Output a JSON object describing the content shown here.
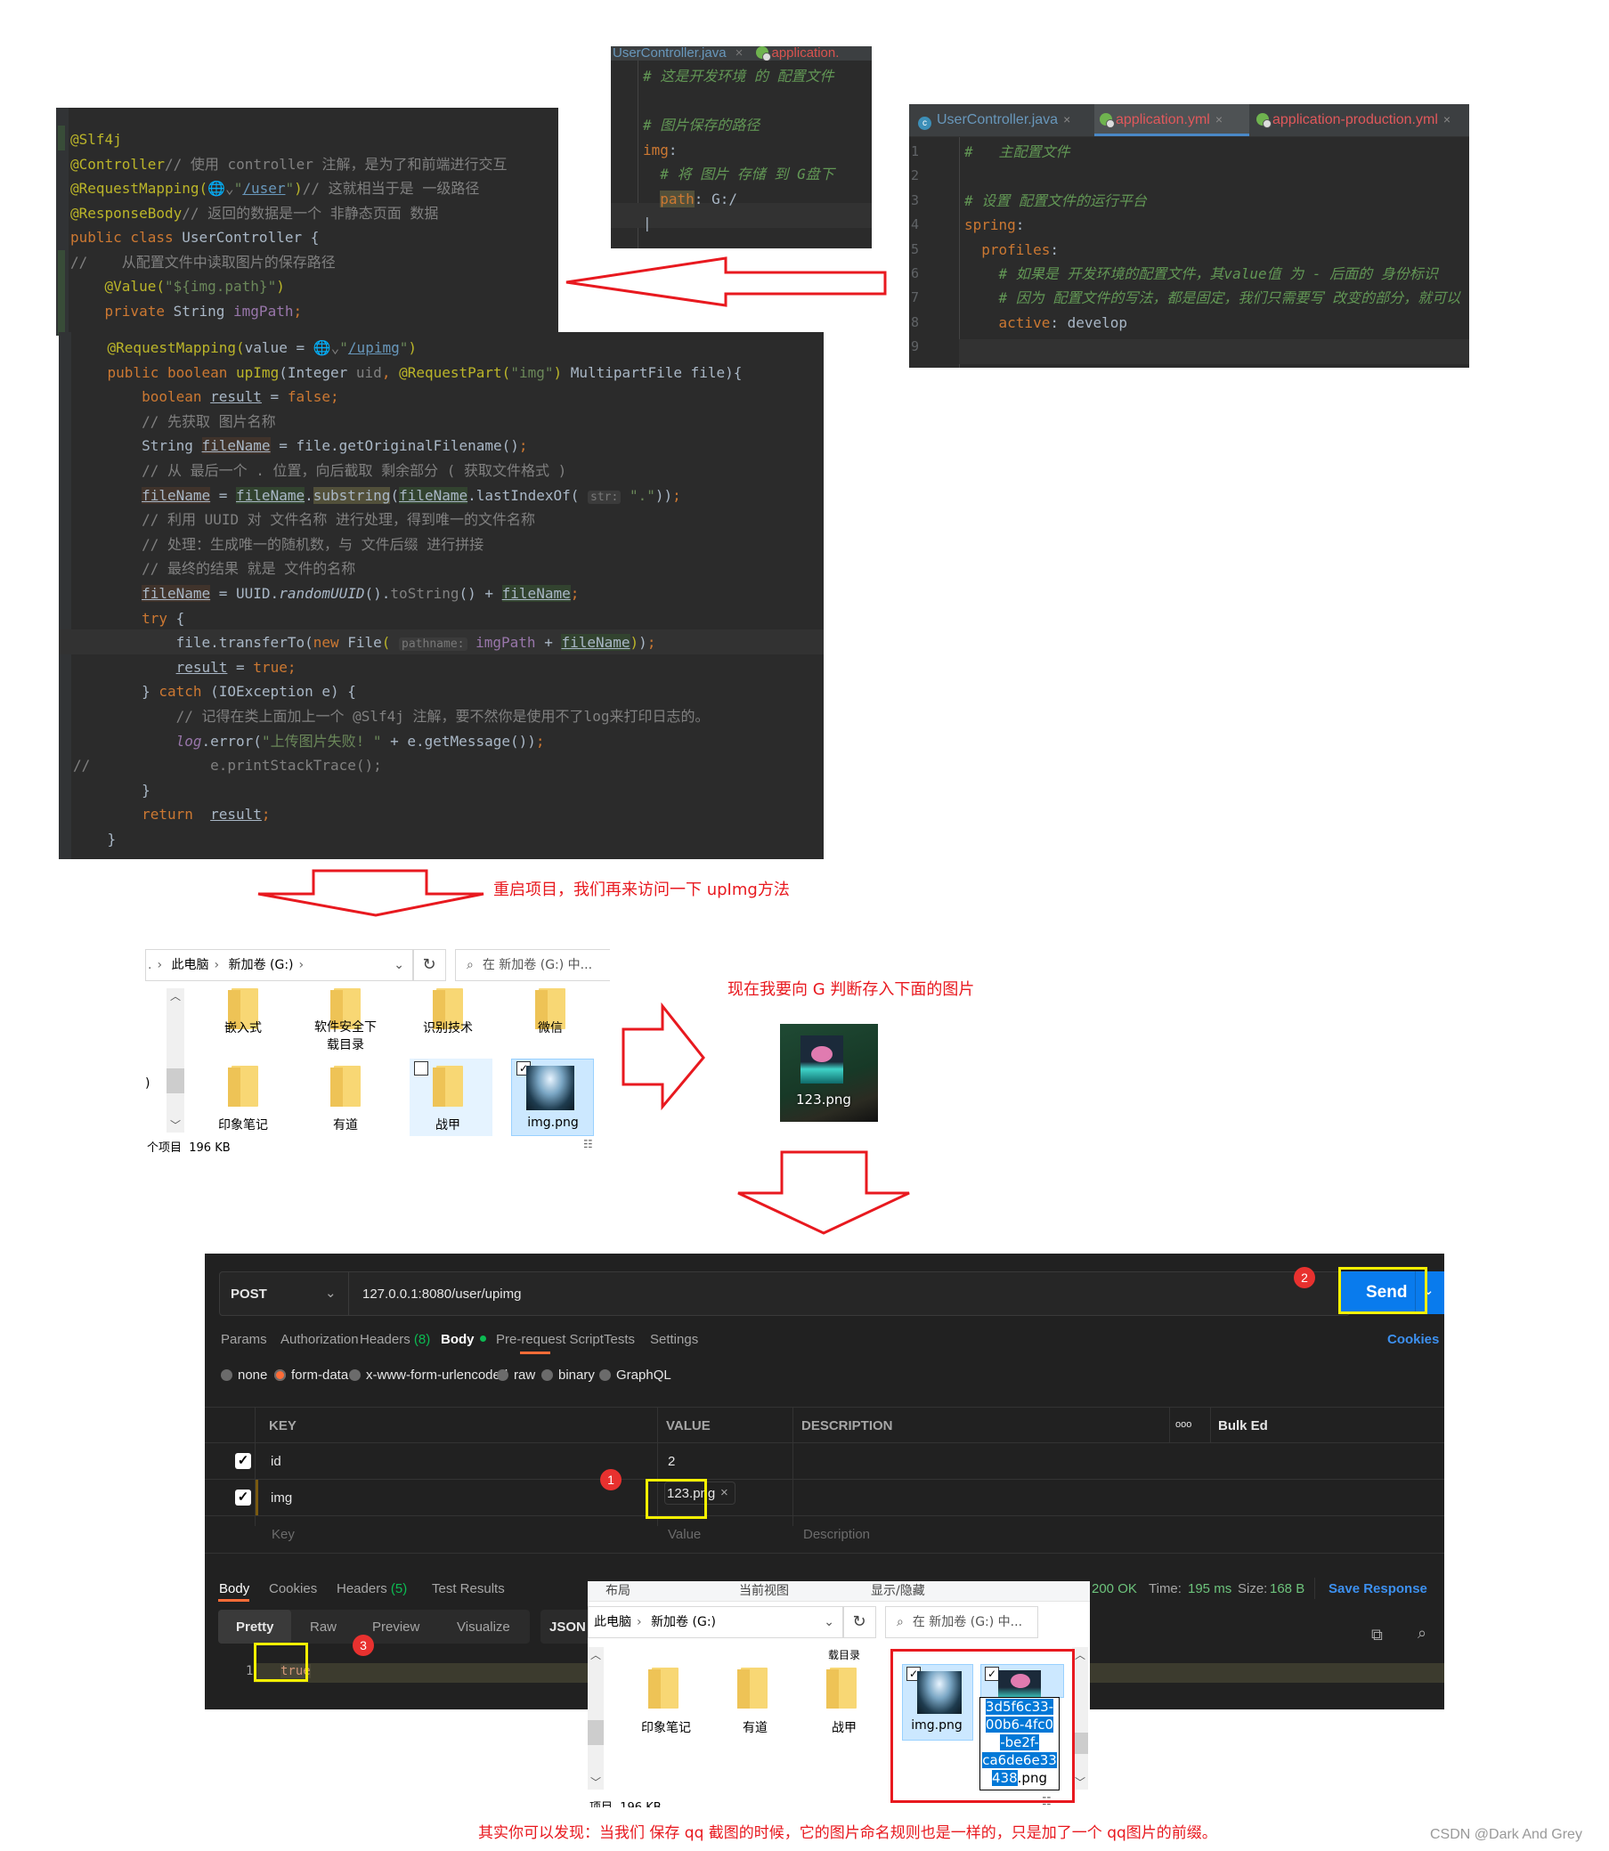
{
  "java_top": {
    "lines": [
      {
        "segments": [
          [
            "ann",
            "@Slf4j"
          ]
        ]
      },
      {
        "segments": [
          [
            "ann",
            "@Controller"
          ],
          [
            "cm",
            "// 使用 controller 注解，是为了和前端进行交互"
          ]
        ]
      },
      {
        "segments": [
          [
            "ann",
            "@RequestMapping("
          ],
          [
            "cm",
            "🌐⌄"
          ],
          [
            "str",
            "\""
          ],
          [
            "lnk",
            "/user"
          ],
          [
            "str",
            "\""
          ],
          [
            "ann",
            ")"
          ],
          [
            "cm",
            "// 这就相当于是 一级路径"
          ]
        ]
      },
      {
        "segments": [
          [
            "ann",
            "@ResponseBody"
          ],
          [
            "cm",
            "// 返回的数据是一个 非静态页面 数据"
          ]
        ]
      },
      {
        "segments": [
          [
            "kw",
            "public class "
          ],
          [
            "txt",
            "UserController {"
          ]
        ]
      },
      {
        "segments": [
          [
            "cm",
            "//    从配置文件中读取图片的保存路径"
          ]
        ]
      },
      {
        "segments": [
          [
            "txt",
            "    "
          ],
          [
            "ann",
            "@Value("
          ],
          [
            "str",
            "\"${img.path}\""
          ],
          [
            "ann",
            ")"
          ]
        ]
      },
      {
        "segments": [
          [
            "txt",
            "    "
          ],
          [
            "kw",
            "private "
          ],
          [
            "txt",
            "String "
          ],
          [
            "fld",
            "imgPath"
          ],
          [
            "kw",
            ";"
          ]
        ]
      }
    ]
  },
  "java_bottom": {
    "lines": [
      {
        "segments": [
          [
            "txt",
            "    "
          ],
          [
            "ann",
            "@RequestMapping("
          ],
          [
            "txt",
            "value = "
          ],
          [
            "cm",
            "🌐⌄"
          ],
          [
            "str",
            "\""
          ],
          [
            "lnk",
            "/upimg"
          ],
          [
            "str",
            "\""
          ],
          [
            "ann",
            ")"
          ]
        ]
      },
      {
        "segments": [
          [
            "txt",
            "    "
          ],
          [
            "kw",
            "public boolean "
          ],
          [
            "ann",
            "upImg"
          ],
          [
            "txt",
            "(Integer "
          ],
          [
            "cm",
            "uid"
          ],
          [
            "kw",
            ", "
          ],
          [
            "ann",
            "@RequestPart("
          ],
          [
            "str",
            "\"img\""
          ],
          [
            "ann",
            ")"
          ],
          [
            "txt",
            " MultipartFile file){"
          ]
        ]
      },
      {
        "segments": [
          [
            "txt",
            "        "
          ],
          [
            "kw",
            "boolean "
          ],
          [
            "ul",
            "result"
          ],
          [
            "txt",
            " = "
          ],
          [
            "kw",
            "false;"
          ]
        ]
      },
      {
        "segments": [
          [
            "txt",
            "        "
          ],
          [
            "cm",
            "// 先获取 图片名称"
          ]
        ]
      },
      {
        "segments": [
          [
            "txt",
            "        String "
          ],
          [
            "ulrd",
            "fileName"
          ],
          [
            "txt",
            " = file.getOriginalFilename()"
          ],
          [
            "kw",
            ";"
          ]
        ]
      },
      {
        "segments": [
          [
            "txt",
            "        "
          ],
          [
            "cm",
            "// 从 最后一个 . 位置，向后截取 剩余部分 ( 获取文件格式 )"
          ]
        ]
      },
      {
        "segments": [
          [
            "txt",
            "        "
          ],
          [
            "ulrd",
            "fileName"
          ],
          [
            "txt",
            " = "
          ],
          [
            "ulgr",
            "fileName"
          ],
          [
            "txt",
            "."
          ],
          [
            "ol",
            "substring"
          ],
          [
            "txt",
            "("
          ],
          [
            "ulgr",
            "fileName"
          ],
          [
            "txt",
            ".lastIndexOf( "
          ],
          [
            "hint",
            "str:"
          ],
          [
            "str",
            " \".\""
          ],
          [
            "txt",
            "))"
          ],
          [
            "kw",
            ";"
          ]
        ]
      },
      {
        "segments": [
          [
            "txt",
            "        "
          ],
          [
            "cm",
            "// 利用 UUID 对 文件名称 进行处理，得到唯一的文件名称"
          ]
        ]
      },
      {
        "segments": [
          [
            "txt",
            "        "
          ],
          [
            "cm",
            "// 处理：生成唯一的随机数，与 文件后缀 进行拼接"
          ]
        ]
      },
      {
        "segments": [
          [
            "txt",
            "        "
          ],
          [
            "cm",
            "// 最终的结果 就是 文件的名称"
          ]
        ]
      },
      {
        "segments": [
          [
            "txt",
            "        "
          ],
          [
            "ulrd",
            "fileName"
          ],
          [
            "txt",
            " = UUID."
          ],
          [
            "ital",
            "randomUUID"
          ],
          [
            "txt",
            "()."
          ],
          [
            "cm",
            "toString"
          ],
          [
            "txt",
            "() + "
          ],
          [
            "ulgr",
            "fileName"
          ],
          [
            "kw",
            ";"
          ]
        ]
      },
      {
        "segments": [
          [
            "txt",
            "        "
          ],
          [
            "kw",
            "try "
          ],
          [
            "txt",
            "{"
          ]
        ]
      },
      {
        "segments": [
          [
            "txt",
            "            file.transferTo("
          ],
          [
            "kw",
            "new "
          ],
          [
            "txt",
            "File"
          ],
          [
            "ann",
            "( "
          ],
          [
            "hint",
            "pathname:"
          ],
          [
            "fld",
            " imgPath"
          ],
          [
            "txt",
            " + "
          ],
          [
            "ulgr",
            "fileName"
          ],
          [
            "ann",
            ")"
          ],
          [
            "txt",
            ")"
          ],
          [
            "kw",
            ";"
          ]
        ]
      },
      {
        "segments": [
          [
            "txt",
            "            "
          ],
          [
            "ul",
            "result"
          ],
          [
            "txt",
            " = "
          ],
          [
            "kw",
            "true;"
          ]
        ]
      },
      {
        "segments": [
          [
            "txt",
            "        } "
          ],
          [
            "kw",
            "catch "
          ],
          [
            "txt",
            "(IOException e) {"
          ]
        ]
      },
      {
        "segments": [
          [
            "txt",
            "            "
          ],
          [
            "cm",
            "// 记得在类上面加上一个 @Slf4j 注解，要不然你是使用不了log来打印日志的。"
          ]
        ]
      },
      {
        "segments": [
          [
            "txt",
            "            "
          ],
          [
            "fldi",
            "log"
          ],
          [
            "txt",
            ".error("
          ],
          [
            "str",
            "\"上传图片失败! \""
          ],
          [
            "txt",
            " + e.getMessage())"
          ],
          [
            "kw",
            ";"
          ]
        ]
      },
      {
        "segments": [
          [
            "cm",
            "//              e.printStackTrace();"
          ]
        ]
      },
      {
        "segments": [
          [
            "txt",
            "        }"
          ]
        ]
      },
      {
        "segments": [
          [
            "txt",
            "        "
          ],
          [
            "kw",
            "return  "
          ],
          [
            "ul",
            "result"
          ],
          [
            "kw",
            ";"
          ]
        ]
      },
      {
        "segments": [
          [
            "txt",
            "    }"
          ]
        ]
      }
    ]
  },
  "yml_dev": {
    "tab_left": "UserController.java",
    "tab_right": "application.",
    "lines": [
      {
        "segments": [
          [
            "ycm",
            "# 这是开发环境 的 配置文件"
          ]
        ]
      },
      {
        "segments": []
      },
      {
        "segments": [
          [
            "ycm",
            "# 图片保存的路径"
          ]
        ]
      },
      {
        "segments": [
          [
            "ykey",
            "img"
          ],
          [
            "txt",
            ":"
          ]
        ]
      },
      {
        "segments": [
          [
            "txt",
            "  "
          ],
          [
            "ycm",
            "# 将 图片 存储 到 G盘下"
          ]
        ]
      },
      {
        "segments": [
          [
            "txt",
            "  "
          ],
          [
            "ykeyhl",
            "path"
          ],
          [
            "txt",
            ": G:/"
          ]
        ]
      },
      {
        "segments": [
          [
            "txt",
            "|"
          ]
        ]
      }
    ]
  },
  "yml_main": {
    "tabs": [
      {
        "label": "UserController.java",
        "icon": "java-class-icon",
        "active": false
      },
      {
        "label": "application.yml",
        "icon": "spring-config-icon",
        "active": true
      },
      {
        "label": "application-production.yml",
        "icon": "spring-config-icon",
        "active": false
      }
    ],
    "line_numbers": [
      "1",
      "2",
      "3",
      "4",
      "5",
      "6",
      "7",
      "8",
      "9"
    ],
    "lines": [
      {
        "segments": [
          [
            "ycm",
            "#   主配置文件"
          ]
        ]
      },
      {
        "segments": []
      },
      {
        "segments": [
          [
            "ycm",
            "# 设置 配置文件的运行平台"
          ]
        ]
      },
      {
        "segments": [
          [
            "ykey",
            "spring"
          ],
          [
            "txt",
            ":"
          ]
        ]
      },
      {
        "segments": [
          [
            "txt",
            "  "
          ],
          [
            "ykey",
            "profiles"
          ],
          [
            "txt",
            ":"
          ]
        ]
      },
      {
        "segments": [
          [
            "txt",
            "    "
          ],
          [
            "ycm",
            "# 如果是 开发环境的配置文件，其value值 为 - 后面的 身份标识"
          ]
        ]
      },
      {
        "segments": [
          [
            "txt",
            "    "
          ],
          [
            "ycm",
            "# 因为 配置文件的写法，都是固定，我们只需要写 改变的部分，就可以"
          ]
        ]
      },
      {
        "segments": [
          [
            "txt",
            "    "
          ],
          [
            "ykey",
            "active"
          ],
          [
            "txt",
            ": develop"
          ]
        ]
      },
      {
        "segments": []
      }
    ]
  },
  "annotations": {
    "restart_note": "重启项目，我们再来访问一下 upImg方法",
    "store_note": "现在我要向 G 判断存入下面的图片",
    "footer_note": "其实你可以发现：当我们 保存 qq 截图的时候，它的图片命名规则也是一样的，只是加了一个 qq图片的前缀。",
    "watermark": "CSDN @Dark And Grey",
    "colors": {
      "annotation_red": "#e8191f",
      "highlight_yellow": "#f6f000"
    }
  },
  "explorer_top": {
    "breadcrumb": [
      ".",
      "此电脑",
      "新加卷 (G:)"
    ],
    "search_placeholder": "在 新加卷 (G:) 中...",
    "items_row1": [
      "嵌入式",
      "软件安全下载目录",
      "识别技术",
      "微信"
    ],
    "items_row2": [
      "印象笔记",
      "有道",
      "战甲",
      "img.png"
    ],
    "status": "个项目  196 KB",
    "left_fragment": ")"
  },
  "desktop_file": {
    "name": "123.png"
  },
  "postman": {
    "method": "POST",
    "url": "127.0.0.1:8080/user/upimg",
    "send_label": "Send",
    "request_tabs": [
      {
        "label": "Params"
      },
      {
        "label": "Authorization"
      },
      {
        "label": "Headers",
        "count": "(8)"
      },
      {
        "label": "Body",
        "active": true
      },
      {
        "label": "Pre-request Script"
      },
      {
        "label": "Tests"
      },
      {
        "label": "Settings"
      }
    ],
    "cookies_link": "Cookies",
    "body_types": [
      {
        "label": "none",
        "selected": false
      },
      {
        "label": "form-data",
        "selected": true
      },
      {
        "label": "x-www-form-urlencoded",
        "selected": false
      },
      {
        "label": "raw",
        "selected": false
      },
      {
        "label": "binary",
        "selected": false
      },
      {
        "label": "GraphQL",
        "selected": false
      }
    ],
    "table": {
      "headers": [
        "KEY",
        "VALUE",
        "DESCRIPTION"
      ],
      "more_icon": "ooo",
      "bulk_edit": "Bulk Ed",
      "rows": [
        {
          "checked": true,
          "key": "id",
          "value": "2",
          "description": ""
        },
        {
          "checked": true,
          "key": "img",
          "value": "123.png",
          "description": "",
          "is_file": true
        }
      ],
      "placeholder": {
        "key": "Key",
        "value": "Value",
        "description": "Description"
      }
    },
    "response_tabs": [
      {
        "label": "Body",
        "active": true
      },
      {
        "label": "Cookies"
      },
      {
        "label": "Headers",
        "count": "(5)"
      },
      {
        "label": "Test Results"
      }
    ],
    "status": "200 OK",
    "time_label": "Time:",
    "time_value": "195 ms",
    "size_label": "Size:",
    "size_value": "168 B",
    "save_response": "Save Response",
    "view_modes": [
      "Pretty",
      "Raw",
      "Preview",
      "Visualize"
    ],
    "format": "JSON",
    "response_line_number": "1",
    "response_body": "true",
    "step_badges": [
      "1",
      "2",
      "3"
    ]
  },
  "explorer_bottom": {
    "ribbon": [
      "布局",
      "当前视图",
      "显示/隐藏"
    ],
    "breadcrumb": [
      "此电脑",
      "新加卷 (G:)"
    ],
    "search_placeholder": "在 新加卷 (G:) 中...",
    "partial_label": "载目录",
    "items": [
      "印象笔记",
      "有道",
      "战甲",
      "img.png"
    ],
    "renamed_file": {
      "selected_text": "3d5f6c33-00b6-4fc0-be2f-ca6de6e33438",
      "lines": [
        "3d5f6c33-",
        "00b6-4fc0",
        "-be2f-",
        "ca6de6e33",
        "438"
      ],
      "extension": ".png"
    },
    "status": "项目  196 KB"
  }
}
